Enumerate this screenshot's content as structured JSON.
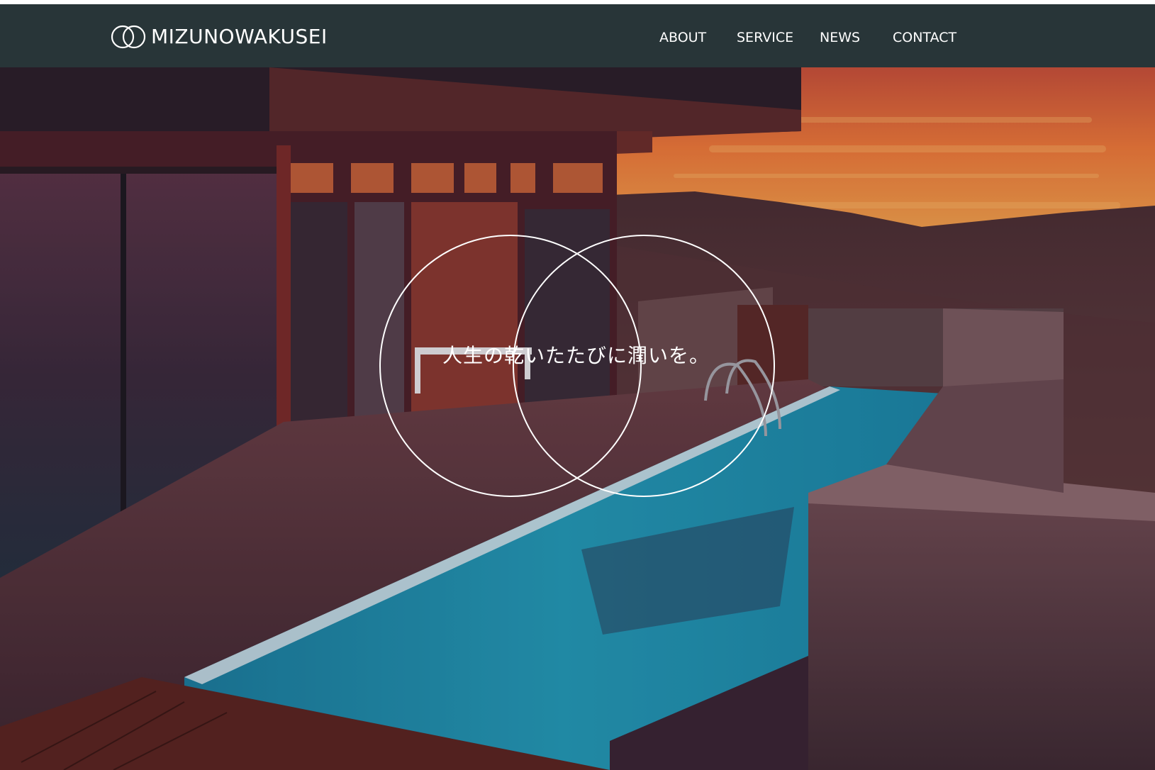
{
  "header": {
    "logo_text": "MIZUNOWAKUSEI",
    "logo_icon": "double-ring-logo-icon",
    "background_color": "#283538"
  },
  "nav": {
    "items": [
      {
        "label": "ABOUT"
      },
      {
        "label": "SERVICE"
      },
      {
        "label": "NEWS"
      },
      {
        "label": "CONTACT"
      }
    ]
  },
  "hero": {
    "tagline": "人生の乾いたたびに潤いを。",
    "decoration_icon": "overlapping-circles-icon",
    "photo_subject": "sunset-villa-pool-photo",
    "colors": {
      "sky": "#f0763a",
      "pool": "#1f8fb0",
      "wall": "#4a2c3a"
    }
  }
}
